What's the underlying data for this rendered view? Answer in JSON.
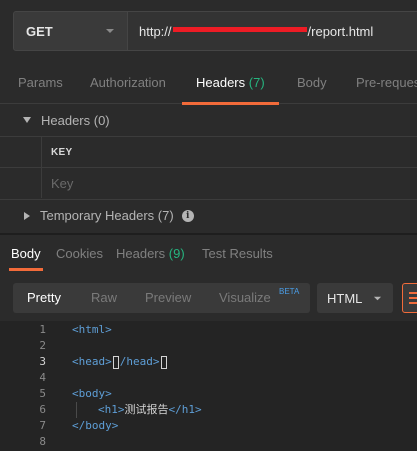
{
  "request": {
    "method": "GET",
    "url_prefix": "http://",
    "url_suffix": "/report.html"
  },
  "request_tabs": [
    {
      "label": "Params",
      "count": ""
    },
    {
      "label": "Authorization",
      "count": ""
    },
    {
      "label": "Headers",
      "count": "(7)"
    },
    {
      "label": "Body",
      "count": ""
    },
    {
      "label": "Pre-reques",
      "count": ""
    }
  ],
  "headers_section": {
    "title": "Headers (0)",
    "key_column": "KEY",
    "key_placeholder": "Key",
    "temporary_title": "Temporary Headers (7)",
    "info_glyph": "i"
  },
  "response_tabs": [
    {
      "label": "Body",
      "count": ""
    },
    {
      "label": "Cookies",
      "count": ""
    },
    {
      "label": "Headers",
      "count": "(9)"
    },
    {
      "label": "Test Results",
      "count": ""
    }
  ],
  "view_modes": {
    "pretty": "Pretty",
    "raw": "Raw",
    "preview": "Preview",
    "visualize": "Visualize",
    "beta": "BETA"
  },
  "format": "HTML",
  "code": {
    "line_numbers": [
      "1",
      "2",
      "3",
      "4",
      "5",
      "6",
      "7",
      "8"
    ],
    "line1": "<html>",
    "line3_open": "<head>",
    "line3_close": "/head>",
    "line5": "<body>",
    "line6_open": "<h1>",
    "line6_text": "测试报告",
    "line6_close": "</h1>",
    "line7": "</body>"
  },
  "colors": {
    "accent": "#f26b3a",
    "count_green": "#26b47f",
    "tag_blue": "#5e9ed6",
    "beta_blue": "#4a9ee8",
    "redaction": "#ee1c25"
  },
  "icons": {
    "method_dropdown": "chevron-down-icon",
    "headers_toggle": "triangle-down-icon",
    "temp_toggle": "triangle-right-icon",
    "info": "info-icon",
    "format_dropdown": "chevron-down-icon",
    "wrap": "wrap-lines-icon"
  }
}
